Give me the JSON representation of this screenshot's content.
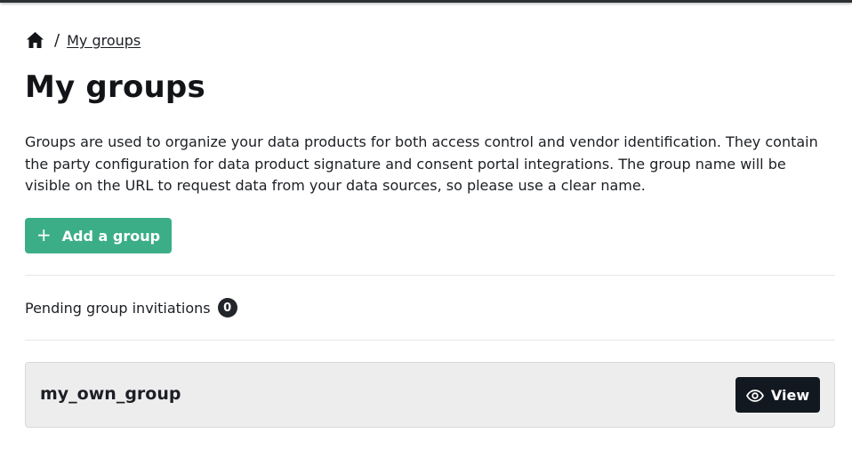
{
  "breadcrumb": {
    "home_icon": "home-icon",
    "separator": "/",
    "current": "My groups"
  },
  "page": {
    "title": "My groups",
    "description": "Groups are used to organize your data products for both access control and vendor identification. They contain the party configuration for data product signature and consent portal integrations. The group name will be visible on the URL to request data from your data sources, so please use a clear name."
  },
  "actions": {
    "add_group_icon": "+",
    "add_group_label": "Add a group"
  },
  "pending": {
    "label": "Pending group invitiations",
    "count": "0"
  },
  "groups": [
    {
      "name": "my_own_group",
      "view_label": "View",
      "view_icon": "eye-icon"
    }
  ],
  "colors": {
    "primary_green": "#3cae87",
    "dark_button": "#121820",
    "card_background": "#ededed"
  }
}
